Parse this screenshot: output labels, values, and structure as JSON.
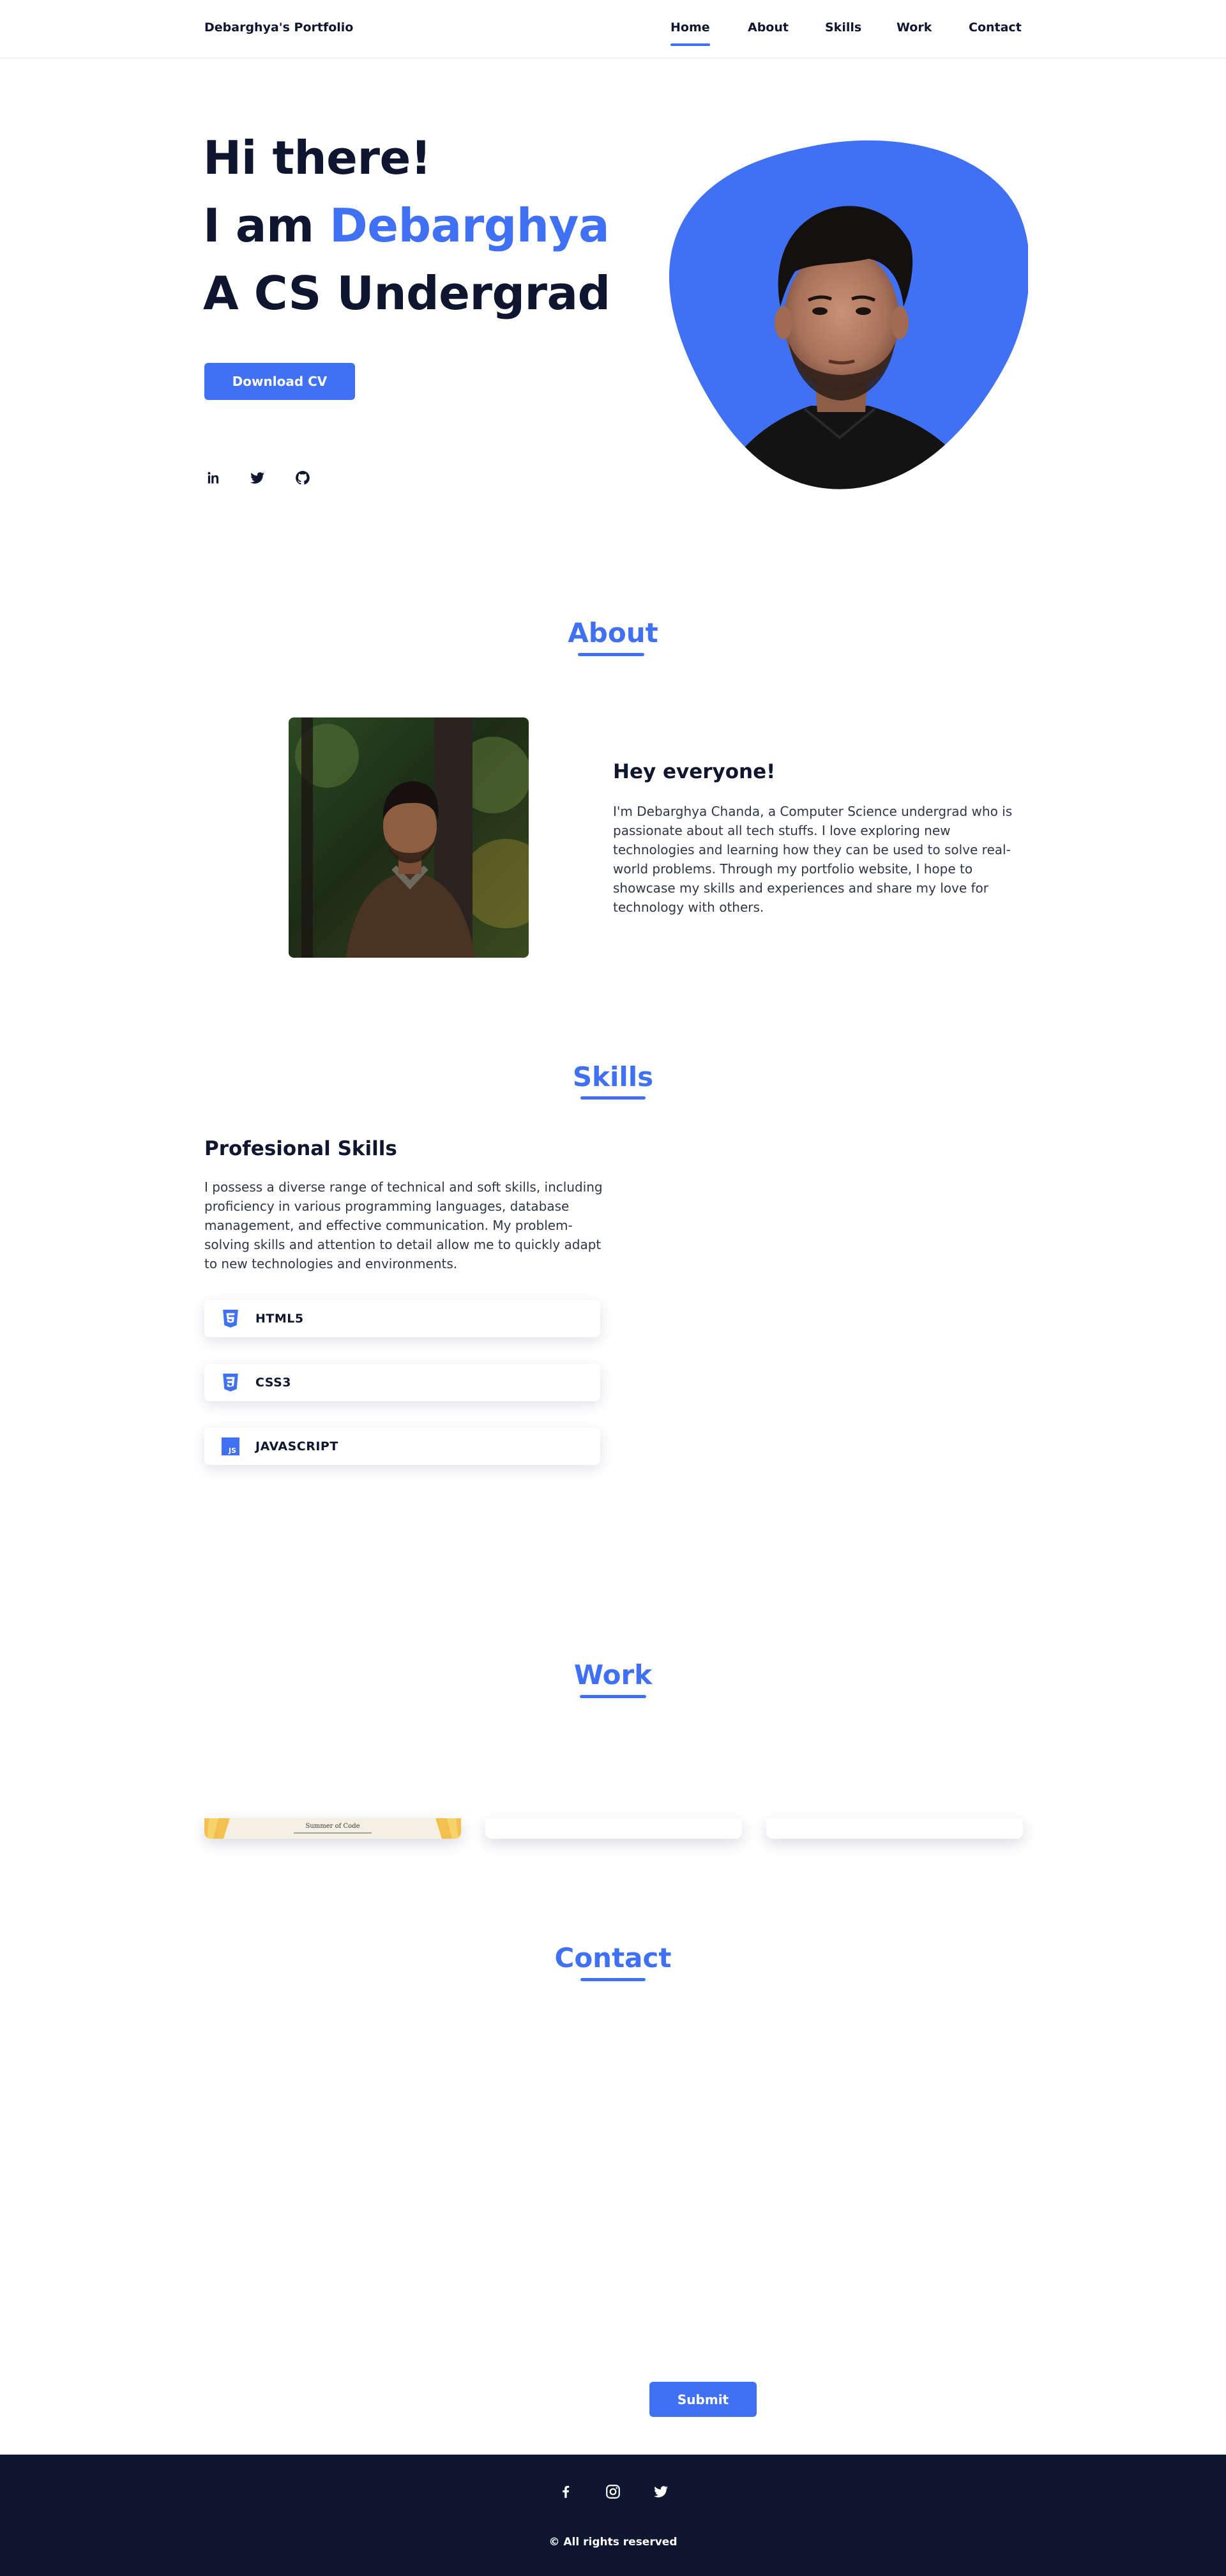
{
  "header": {
    "brand": "Debarghya's Portfolio",
    "nav": [
      "Home",
      "About",
      "Skills",
      "Work",
      "Contact"
    ],
    "active": "Home"
  },
  "hero": {
    "line1": "Hi there!",
    "line2_prefix": "I am ",
    "line2_name": "Debarghya",
    "line3": "A CS Undergrad",
    "cv_button": "Download CV",
    "socials": [
      "linkedin-icon",
      "twitter-icon",
      "github-icon"
    ],
    "blob_color": "#4070f4"
  },
  "about": {
    "title": "About",
    "heading": "Hey everyone!",
    "text": "I'm Debarghya Chanda, a Computer Science undergrad who is passionate about all tech stuffs. I love exploring new technologies and learning how they can be used to solve real-world problems. Through my portfolio website, I hope to showcase my skills and experiences and share my love for technology with others."
  },
  "skills": {
    "title": "Skills",
    "heading": "Profesional Skills",
    "text": "I possess a diverse range of technical and soft skills, including proficiency in various programming languages, database management, and effective communication. My problem-solving skills and attention to detail allow me to quickly adapt to new technologies and environments.",
    "items": [
      {
        "label": "HTML5",
        "icon": "html5-icon"
      },
      {
        "label": "CSS3",
        "icon": "css3-icon"
      },
      {
        "label": "JAVASCRIPT",
        "icon": "javascript-icon"
      }
    ]
  },
  "work": {
    "title": "Work",
    "card1_banner_title": "Summer of Code"
  },
  "contact": {
    "title": "Contact",
    "submit": "Submit"
  },
  "footer": {
    "socials": [
      "facebook-icon",
      "instagram-icon",
      "twitter-icon"
    ],
    "copyright": "© All rights reserved"
  },
  "colors": {
    "accent": "#4070f4",
    "dark": "#0e1630",
    "text": "#2f3547"
  }
}
